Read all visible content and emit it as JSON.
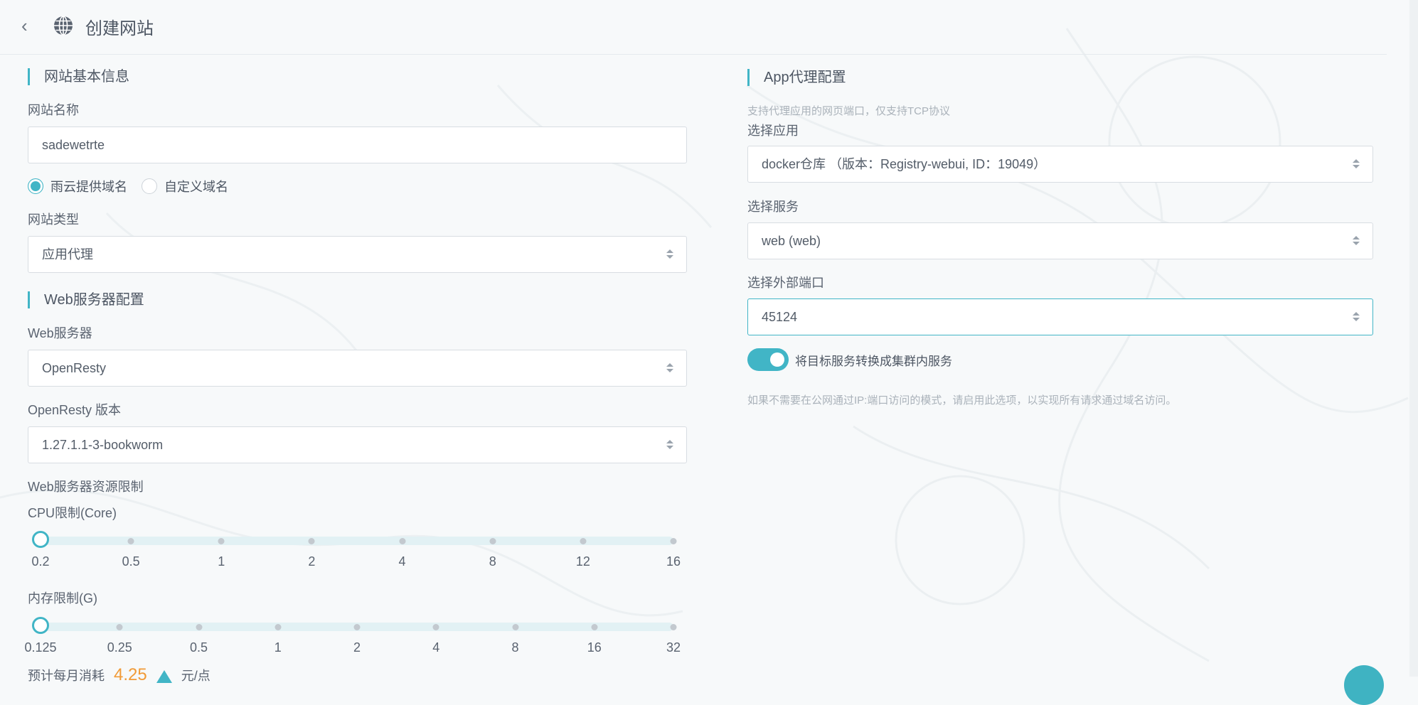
{
  "header": {
    "title": "创建网站",
    "back_icon": "chevron-left-icon",
    "site_icon": "globe-icon"
  },
  "basic": {
    "section_title": "网站基本信息",
    "name_label": "网站名称",
    "name_value": "sadewetrte",
    "domain_options": [
      {
        "label": "雨云提供域名",
        "checked": true
      },
      {
        "label": "自定义域名",
        "checked": false
      }
    ],
    "type_label": "网站类型",
    "type_value": "应用代理"
  },
  "web_server": {
    "section_title": "Web服务器配置",
    "server_label": "Web服务器",
    "server_value": "OpenResty",
    "version_label": "OpenResty 版本",
    "version_value": "1.27.1.1-3-bookworm",
    "resource_label": "Web服务器资源限制",
    "cpu": {
      "label": "CPU限制(Core)",
      "ticks": [
        "0.2",
        "0.5",
        "1",
        "2",
        "4",
        "8",
        "12",
        "16"
      ],
      "selected_index": 0
    },
    "memory": {
      "label": "内存限制(G)",
      "ticks": [
        "0.125",
        "0.25",
        "0.5",
        "1",
        "2",
        "4",
        "8",
        "16",
        "32"
      ],
      "selected_index": 0
    },
    "cost_prefix": "预计每月消耗",
    "cost_value": "4.25",
    "cost_unit": "元/点"
  },
  "app_proxy": {
    "section_title": "App代理配置",
    "hint": "支持代理应用的网页端口，仅支持TCP协议",
    "app_label": "选择应用",
    "app_value": "docker仓库 （版本：Registry-webui, ID：19049）",
    "service_label": "选择服务",
    "service_value": "web (web)",
    "port_label": "选择外部端口",
    "port_value": "45124",
    "toggle_on": true,
    "toggle_label": "将目标服务转换成集群内服务",
    "toggle_hint": "如果不需要在公网通过IP:端口访问的模式，请启用此选项，以实现所有请求通过域名访问。"
  },
  "colors": {
    "accent": "#41b5c6",
    "cost": "#f19b38"
  },
  "help_icon": "help-bubble-icon"
}
